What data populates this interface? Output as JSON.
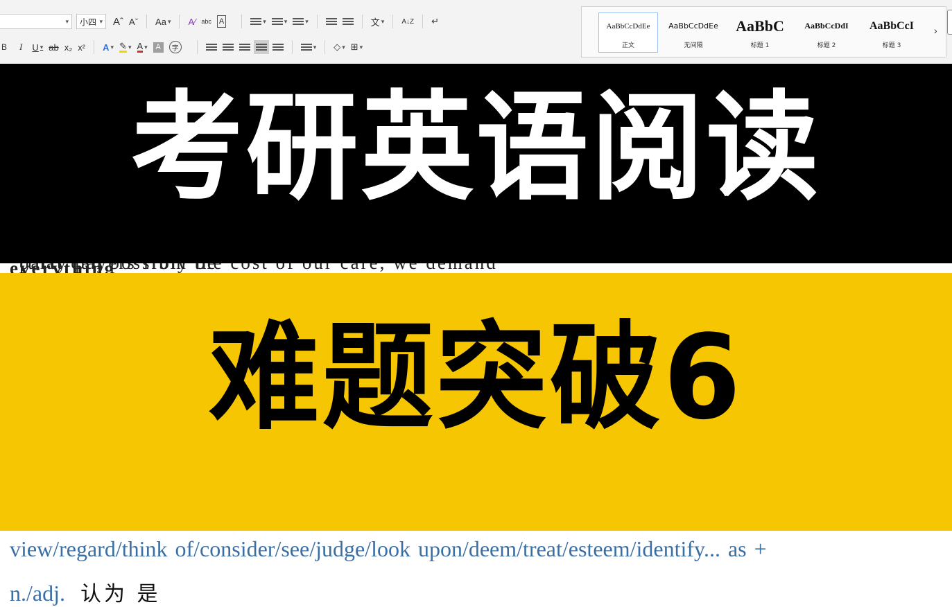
{
  "ribbon": {
    "font_size": "小四",
    "row1": {
      "grow_font": "Aˆ",
      "shrink_font": "Aˇ",
      "change_case": "Aa",
      "clear_format": "A⁄",
      "phonetic": "abc",
      "char_border": "A",
      "sort": "A↓Z",
      "show_marks": "↵",
      "asian_layout": "文"
    },
    "row2": {
      "bold": "B",
      "italic": "I",
      "underline": "U",
      "strikethrough": "ab",
      "subscript": "x₂",
      "superscript": "x²",
      "text_effect": "A",
      "highlight": "✎",
      "font_color": "A",
      "char_shading": "A",
      "enclose": "字"
    },
    "styles": [
      {
        "sample": "AaBbCcDdEe",
        "caption": "正文"
      },
      {
        "sample": "AaBbCcDdEe",
        "caption": "无间隔"
      },
      {
        "sample": "AaBbC",
        "caption": "标题 1"
      },
      {
        "sample": "AaBbCcDdI",
        "caption": "标题 2"
      },
      {
        "sample": "AaBbCcI",
        "caption": "标题 3"
      }
    ],
    "more": "›"
  },
  "banner": {
    "title_top": "考研英语阅读",
    "title_bottom": "难题突破6"
  },
  "doc": {
    "strip_text_a": "party payers from the cost of our care, we demand ",
    "strip_text_bold": "everything",
    "strip_text_b": " (that can possibly be",
    "line1": "view/regard/think  of/consider/see/judge/look  upon/deem/treat/esteem/identify...  as  +",
    "line2": "n./adj.",
    "line2_cn": "认为 是"
  },
  "colors": {
    "ribbon_bg": "#f3f3f3",
    "top_banner": "#000000",
    "bottom_banner": "#f7c602",
    "doc_text": "#3a6fa6",
    "style_selected_border": "#9cc3ef"
  }
}
